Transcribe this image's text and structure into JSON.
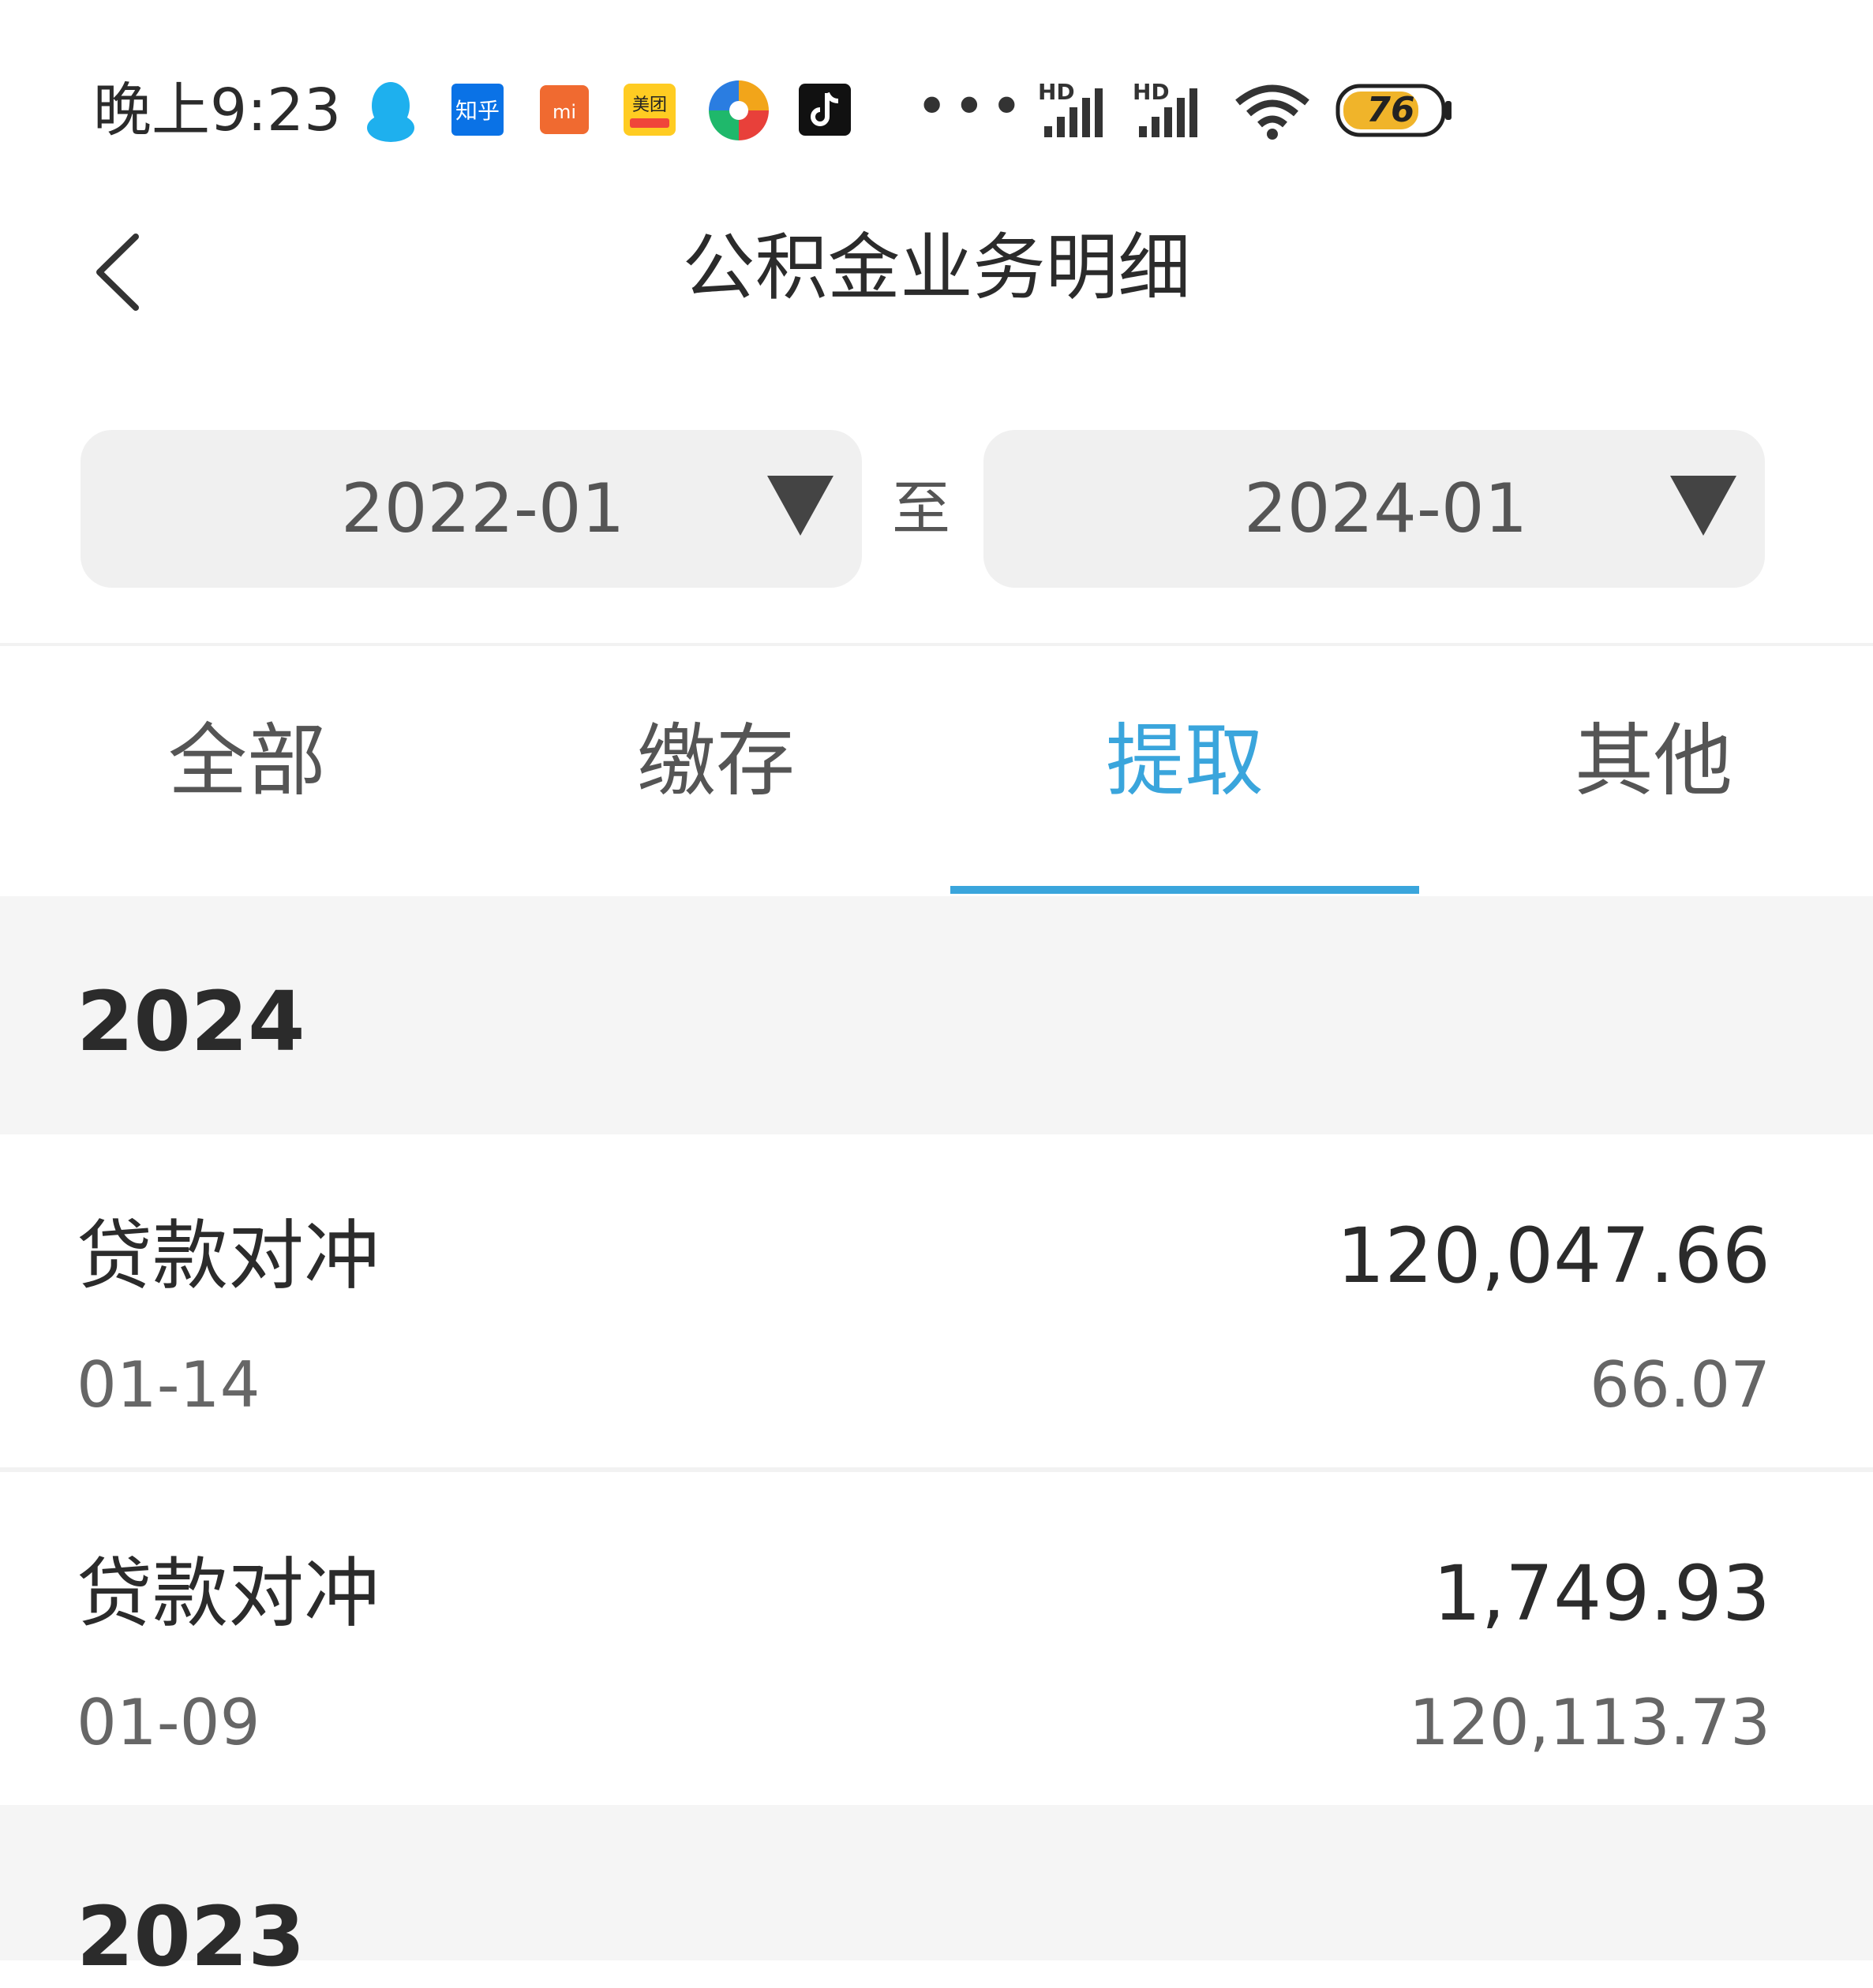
{
  "status_bar": {
    "time": "晚上9:23",
    "notif_icons": [
      "qq-icon",
      "zhihu-icon",
      "mi-icon",
      "meituan-icon",
      "colorful-app-icon",
      "tiktok-icon"
    ],
    "zhihu_text": "知乎",
    "mi_text": "mi",
    "meituan_text": "美团",
    "more": "•••",
    "signal_label": "HD",
    "battery": "76"
  },
  "header": {
    "title": "公积金业务明细"
  },
  "date_range": {
    "start": "2022-01",
    "separator": "至",
    "end": "2024-01"
  },
  "tabs": [
    {
      "label": "全部",
      "active": false
    },
    {
      "label": "缴存",
      "active": false
    },
    {
      "label": "提取",
      "active": true
    },
    {
      "label": "其他",
      "active": false
    }
  ],
  "groups": [
    {
      "year": "2024",
      "records": [
        {
          "type": "贷款对冲",
          "amount": "120,047.66",
          "date": "01-14",
          "balance": "66.07"
        },
        {
          "type": "贷款对冲",
          "amount": "1,749.93",
          "date": "01-09",
          "balance": "120,113.73"
        }
      ]
    },
    {
      "year": "2023",
      "records": []
    }
  ],
  "colors": {
    "accent": "#3aa5dc",
    "header_bg": "#f5f5f5",
    "input_bg": "#f0f0f0"
  }
}
